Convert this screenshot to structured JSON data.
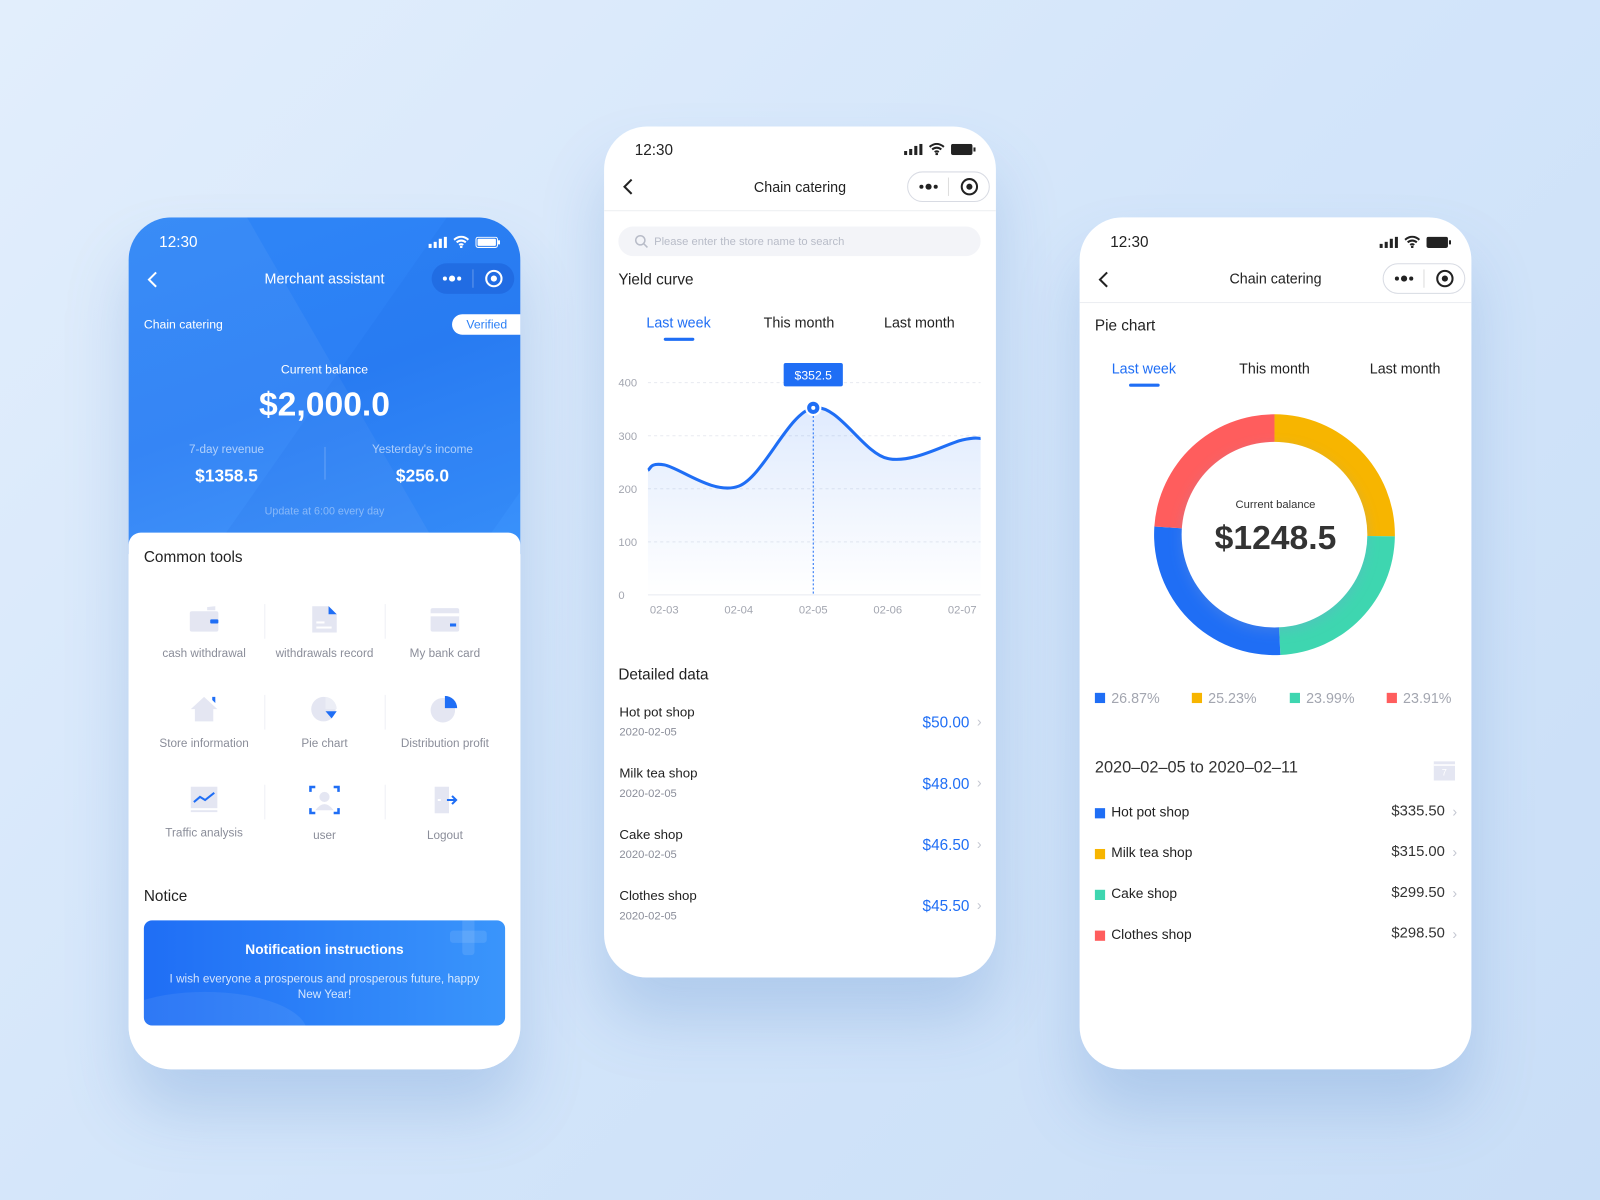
{
  "colors": {
    "primary": "#1f6ef5",
    "yellow": "#f7b500",
    "green": "#3ed6b0",
    "red": "#ff5d5d",
    "background": "#d6e7fb"
  },
  "left": {
    "time": "12:30",
    "title": "Merchant assistant",
    "store": "Chain catering",
    "badge": "Verified",
    "balance_label": "Current balance",
    "balance": "$2,000.0",
    "revenue_label": "7-day revenue",
    "revenue": "$1358.5",
    "income_label": "Yesterday's income",
    "income": "$256.0",
    "update_note": "Update at 6:00 every day",
    "tools_title": "Common tools",
    "tools": [
      {
        "label": "cash withdrawal",
        "icon": "wallet-icon"
      },
      {
        "label": "withdrawals record",
        "icon": "document-icon"
      },
      {
        "label": "My bank card",
        "icon": "bank-card-icon"
      },
      {
        "label": "Store information",
        "icon": "house-icon"
      },
      {
        "label": "Pie chart",
        "icon": "pie-chart-icon"
      },
      {
        "label": "Distribution profit",
        "icon": "pie-slice-icon"
      },
      {
        "label": "Traffic analysis",
        "icon": "line-chart-icon"
      },
      {
        "label": "user",
        "icon": "user-scan-icon"
      },
      {
        "label": "Logout",
        "icon": "logout-icon"
      }
    ],
    "notice_title": "Notice",
    "notice_card_title": "Notification instructions",
    "notice_card_text": "I wish everyone a prosperous and prosperous future, happy New Year!"
  },
  "middle": {
    "time": "12:30",
    "title": "Chain catering",
    "search_placeholder": "Please enter the store name to search",
    "section_title": "Yield curve",
    "tabs": [
      "Last week",
      "This month",
      "Last month"
    ],
    "active_tab": 0,
    "tooltip": "$352.5",
    "detail_title": "Detailed data",
    "rows": [
      {
        "name": "Hot pot shop",
        "date": "2020-02-05",
        "amount": "$50.00"
      },
      {
        "name": "Milk tea shop",
        "date": "2020-02-05",
        "amount": "$48.00"
      },
      {
        "name": "Cake shop",
        "date": "2020-02-05",
        "amount": "$46.50"
      },
      {
        "name": "Clothes shop",
        "date": "2020-02-05",
        "amount": "$45.50"
      }
    ]
  },
  "chart_data": [
    {
      "type": "line",
      "categories": [
        "02-03",
        "02-04",
        "02-05",
        "02-06",
        "02-07"
      ],
      "values": [
        245,
        205,
        352.5,
        257,
        292
      ],
      "y_ticks": [
        "0",
        "100",
        "200",
        "300",
        "400"
      ],
      "ylim": [
        0,
        400
      ],
      "grid": true,
      "highlight": {
        "category": "02-05",
        "value": 352.5
      }
    },
    {
      "type": "pie",
      "donut": true,
      "slices": [
        {
          "label": "Milk tea shop",
          "percent": "25.23%",
          "value": 25.23,
          "color": "#f7b500"
        },
        {
          "label": "Cake shop",
          "percent": "23.99%",
          "value": 23.99,
          "color": "#3ed6b0"
        },
        {
          "label": "Hot pot shop",
          "percent": "26.87%",
          "value": 26.87,
          "color": "#1f6ef5"
        },
        {
          "label": "Clothes shop",
          "percent": "23.91%",
          "value": 23.91,
          "color": "#ff5d5d"
        }
      ],
      "center_label": "Current balance",
      "center_value": "$1248.5"
    }
  ],
  "right": {
    "time": "12:30",
    "title": "Chain catering",
    "section_title": "Pie chart",
    "tabs": [
      "Last week",
      "This month",
      "Last month"
    ],
    "active_tab": 0,
    "legend": [
      {
        "percent": "26.87%",
        "color": "#1f6ef5"
      },
      {
        "percent": "25.23%",
        "color": "#f7b500"
      },
      {
        "percent": "23.99%",
        "color": "#3ed6b0"
      },
      {
        "percent": "23.91%",
        "color": "#ff5d5d"
      }
    ],
    "date_range": "2020–02–05 to 2020–02–11",
    "calendar_day": "7",
    "rows": [
      {
        "name": "Hot pot shop",
        "amount": "$335.50",
        "color": "#1f6ef5"
      },
      {
        "name": "Milk tea shop",
        "amount": "$315.00",
        "color": "#f7b500"
      },
      {
        "name": "Cake shop",
        "amount": "$299.50",
        "color": "#3ed6b0"
      },
      {
        "name": "Clothes shop",
        "amount": "$298.50",
        "color": "#ff5d5d"
      }
    ]
  }
}
